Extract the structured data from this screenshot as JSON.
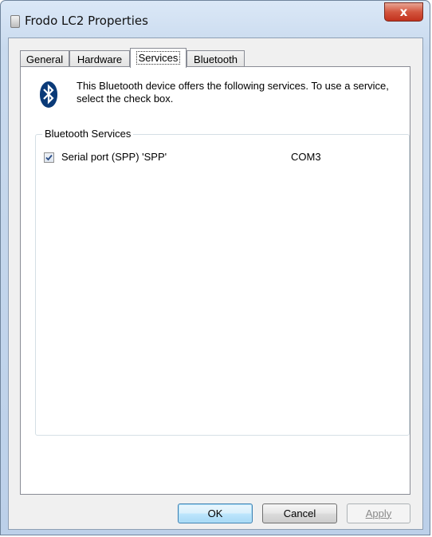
{
  "window": {
    "title": "Frodo LC2 Properties",
    "close_label": "x"
  },
  "tabs": [
    {
      "label": "General"
    },
    {
      "label": "Hardware"
    },
    {
      "label": "Services"
    },
    {
      "label": "Bluetooth"
    }
  ],
  "active_tab": "Services",
  "intro_text": "This Bluetooth device offers the following services. To use a service, select the check box.",
  "group": {
    "label": "Bluetooth Services",
    "services": [
      {
        "name": "Serial port (SPP) 'SPP'",
        "port": "COM3",
        "checked": true
      }
    ]
  },
  "buttons": {
    "ok": "OK",
    "cancel": "Cancel",
    "apply": "Apply"
  },
  "colors": {
    "close_button": "#c2321d",
    "bluetooth_icon": "#0a3a78",
    "default_button_border": "#3c7fb1"
  }
}
